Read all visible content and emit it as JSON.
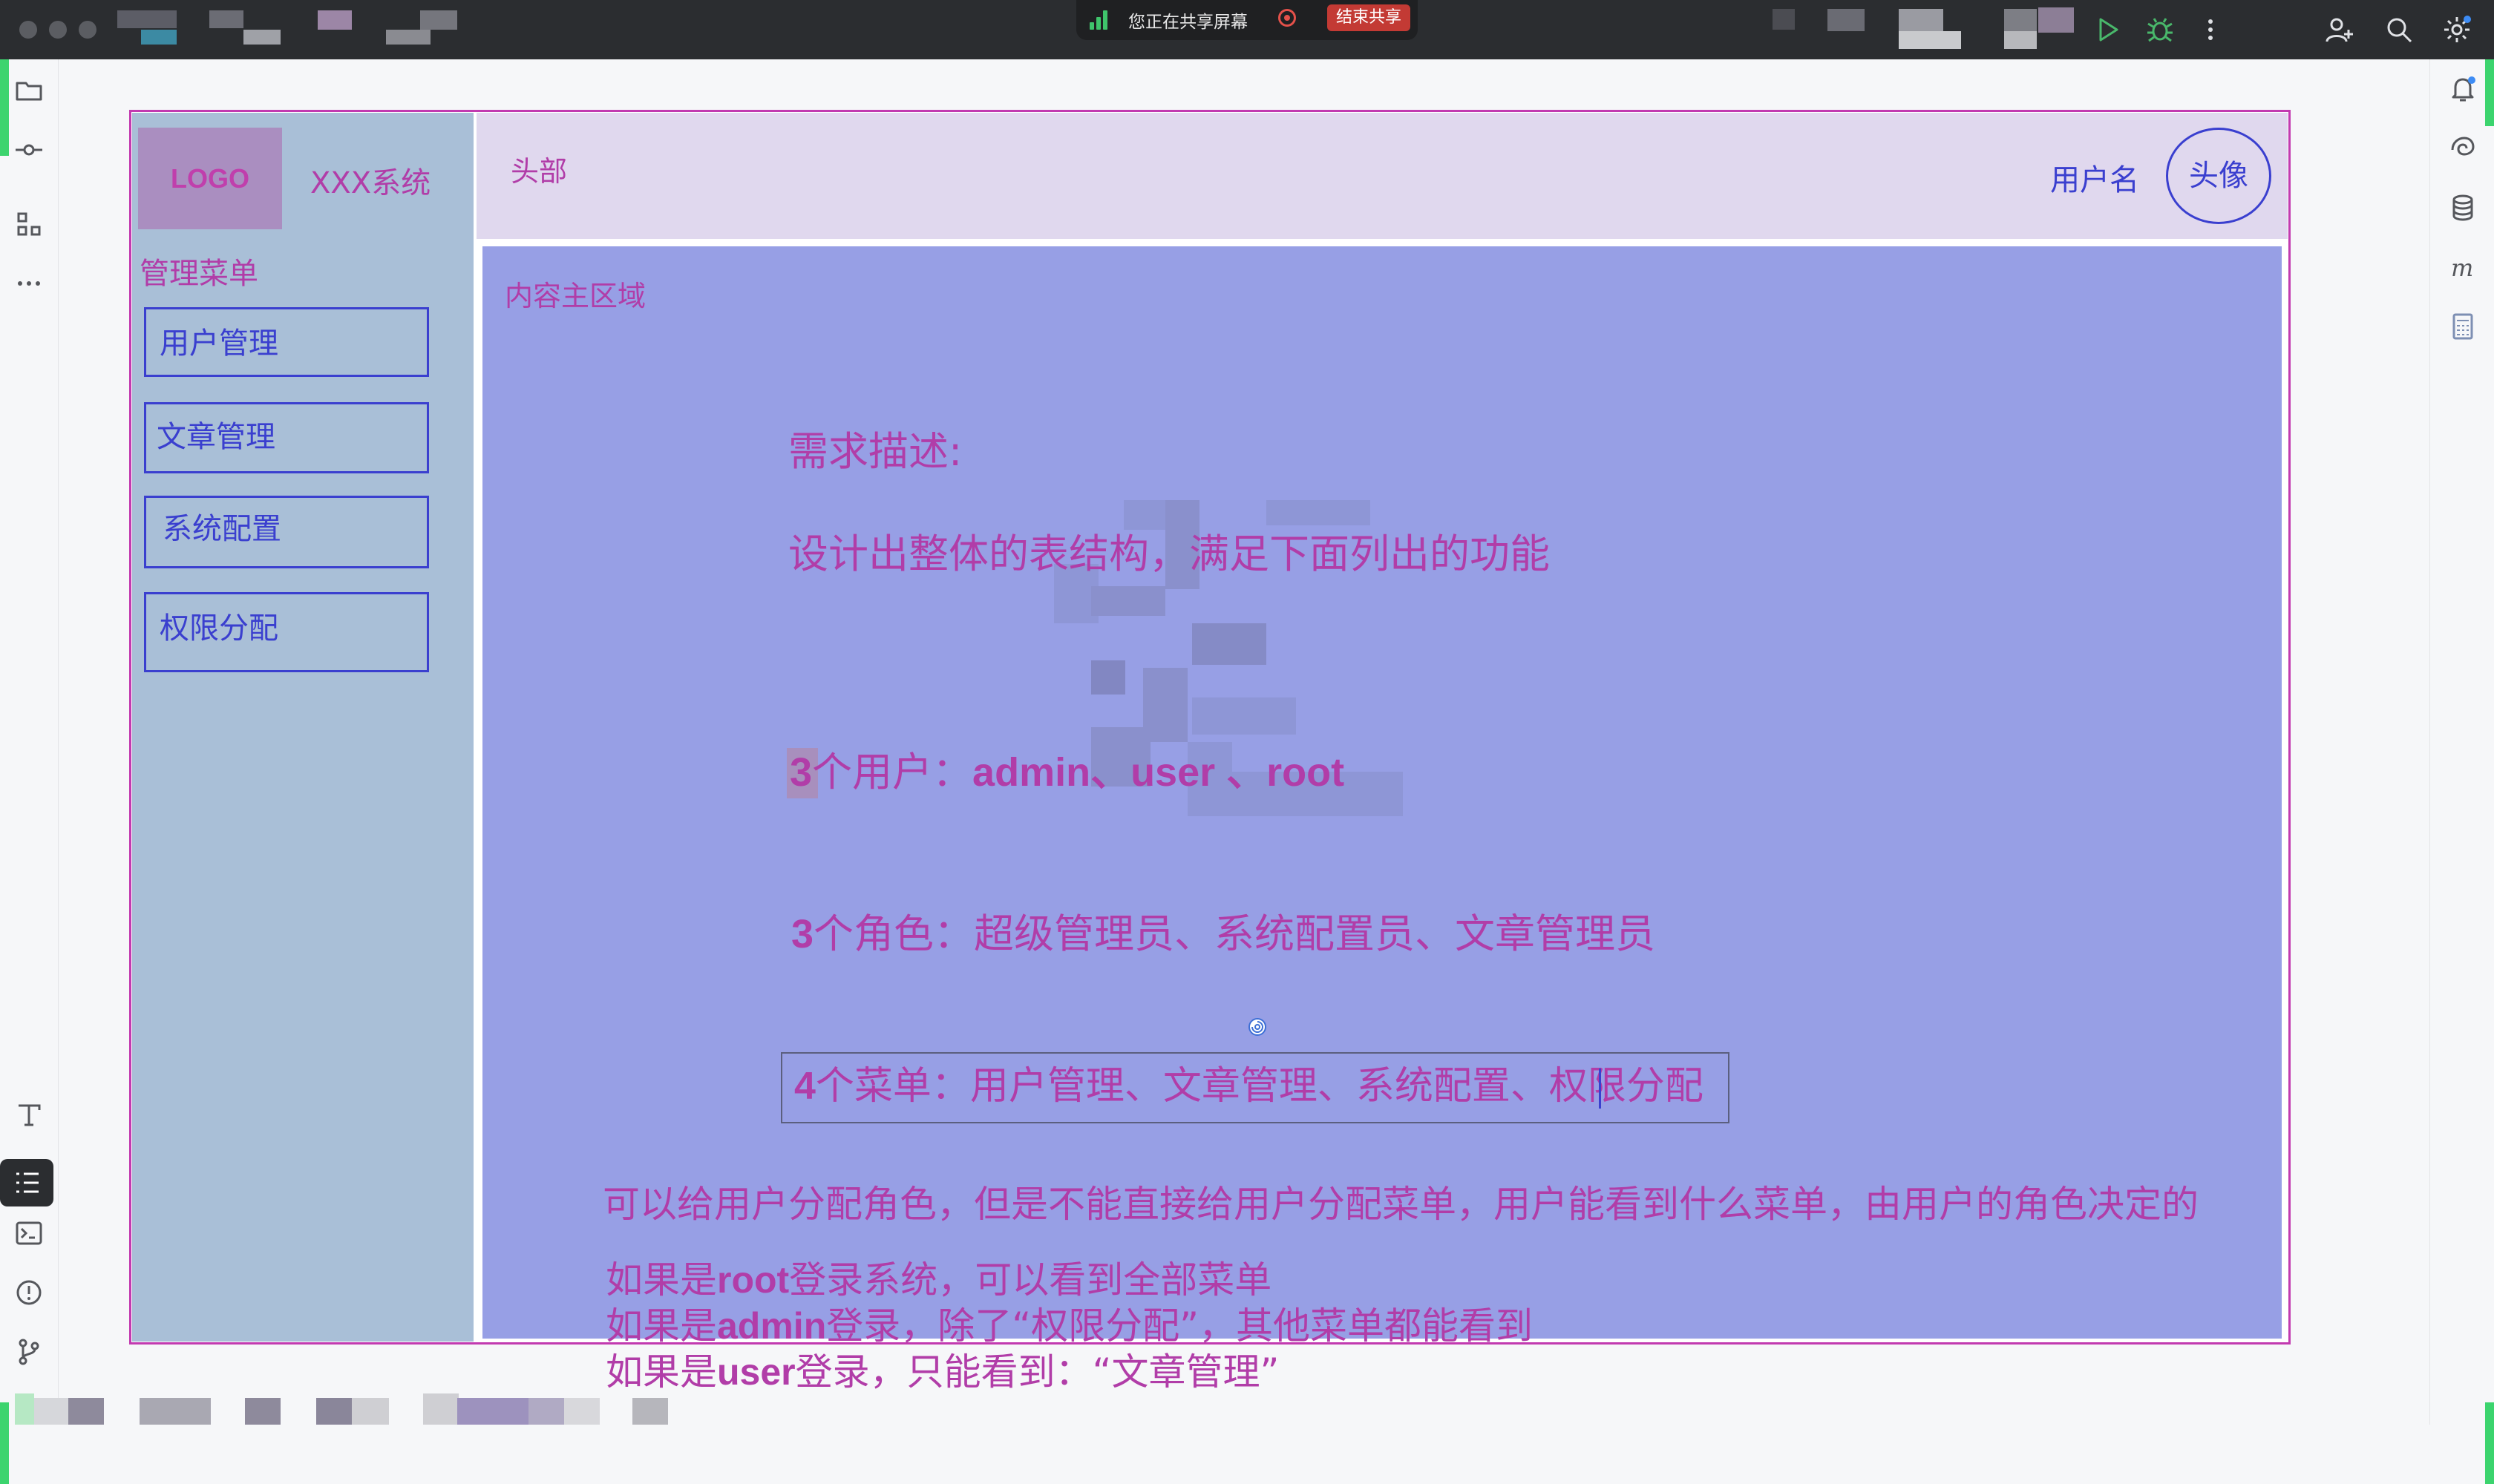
{
  "share_bar": {
    "status_text": "您正在共享屏幕",
    "end_button": "结束共享"
  },
  "colors": {
    "frame_border": "#c23ab0",
    "sidebar_bg": "#a9bfd7",
    "header_bg": "#e0d8ee",
    "content_bg": "#979fe5",
    "text_magenta": "#b13da8",
    "text_blue": "#3a3fcf"
  },
  "left_tools": [
    "folder-icon",
    "commit-icon",
    "structure-icon",
    "more-icon",
    "format-icon",
    "todo-list-icon",
    "terminal-icon",
    "problems-icon",
    "git-branch-icon"
  ],
  "right_tools": [
    "notifications-icon",
    "ai-assistant-icon",
    "database-icon",
    "maven-icon",
    "calculator-icon"
  ],
  "toolbar_icons": [
    "run-icon",
    "debug-icon",
    "more-vertical-icon",
    "add-user-icon",
    "search-icon",
    "settings-icon"
  ],
  "sidebar": {
    "logo": "LOGO",
    "system_name": "XXX系统",
    "menu_title": "管理菜单",
    "items": [
      {
        "label": "用户管理"
      },
      {
        "label": "文章管理"
      },
      {
        "label": "系统配置"
      },
      {
        "label": "权限分配"
      }
    ]
  },
  "header": {
    "label": "头部",
    "username": "用户名",
    "avatar": "头像"
  },
  "content": {
    "label": "内容主区域",
    "requirement_title": "需求描述:",
    "requirement_desc": "设计出整体的表结构，满足下面列出的功能",
    "users_prefix_num": "3",
    "users_prefix": "个用户：",
    "users_list": "admin、user 、root",
    "roles_num": "3",
    "roles_text": "个角色：超级管理员、系统配置员、文章管理员",
    "menus_num": "4",
    "menus_text": "个菜单：用户管理、文章管理、系统配置、权限分配",
    "rule_main": "可以给用户分配角色，但是不能直接给用户分配菜单，用户能看到什么菜单，由用户的角色决定的",
    "rule_root_pre": "如果是",
    "rule_root_user": "root",
    "rule_root_post": "登录系统，可以看到全部菜单",
    "rule_admin_pre": "如果是",
    "rule_admin_user": "admin",
    "rule_admin_post": "登录，除了“权限分配”，其他菜单都能看到",
    "rule_user_pre": "如果是",
    "rule_user_user": "user",
    "rule_user_post": "登录，只能看到：“文章管理”"
  }
}
